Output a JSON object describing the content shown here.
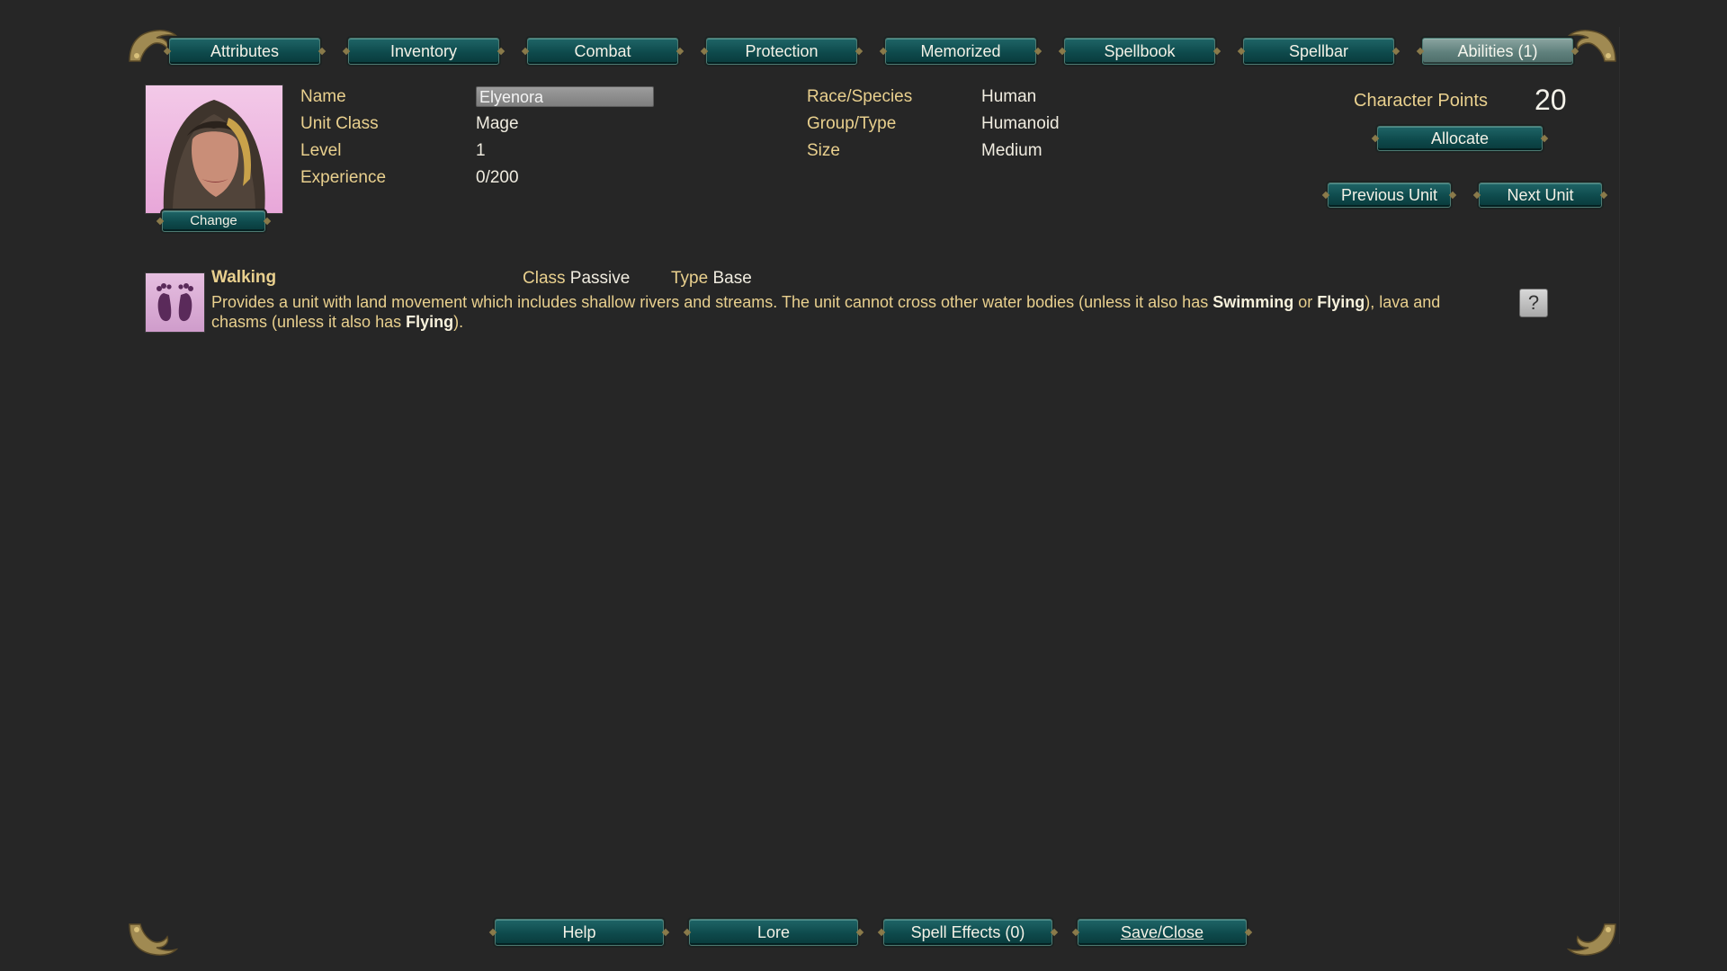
{
  "tabs": [
    {
      "label": "Attributes",
      "active": false
    },
    {
      "label": "Inventory",
      "active": false
    },
    {
      "label": "Combat",
      "active": false
    },
    {
      "label": "Protection",
      "active": false
    },
    {
      "label": "Memorized",
      "active": false
    },
    {
      "label": "Spellbook",
      "active": false
    },
    {
      "label": "Spellbar",
      "active": false
    },
    {
      "label": "Abilities (1)",
      "active": true
    }
  ],
  "portrait": {
    "change_label": "Change",
    "icon": "hooded-mage-portrait"
  },
  "info": {
    "name_label": "Name",
    "name_value": "Elyenora",
    "class_label": "Unit Class",
    "class_value": "Mage",
    "level_label": "Level",
    "level_value": "1",
    "exp_label": "Experience",
    "exp_value": "0/200",
    "race_label": "Race/Species",
    "race_value": "Human",
    "group_label": "Group/Type",
    "group_value": "Humanoid",
    "size_label": "Size",
    "size_value": "Medium"
  },
  "points": {
    "label": "Character Points",
    "value": "20",
    "allocate_label": "Allocate"
  },
  "nav": {
    "prev_label": "Previous Unit",
    "next_label": "Next Unit"
  },
  "ability": {
    "icon": "feet-icon",
    "title": "Walking",
    "class_label": "Class",
    "class_value": "Passive",
    "type_label": "Type",
    "type_value": "Base",
    "desc_1": "Provides a unit with land movement which includes shallow rivers and streams. The unit cannot cross other water bodies (unless it also has ",
    "desc_b1": "Swimming",
    "desc_2": " or ",
    "desc_b2": "Flying",
    "desc_3": "), lava and chasms (unless it also has ",
    "desc_b3": "Flying",
    "desc_4": ").",
    "help_label": "?"
  },
  "bottom": {
    "help_label": "Help",
    "lore_label": "Lore",
    "effects_label": "Spell Effects (0)",
    "save_label": "Save/Close"
  },
  "colors": {
    "accent_gold": "#e9d08e",
    "button_teal": "#0e4a4c",
    "background": "#262626"
  }
}
